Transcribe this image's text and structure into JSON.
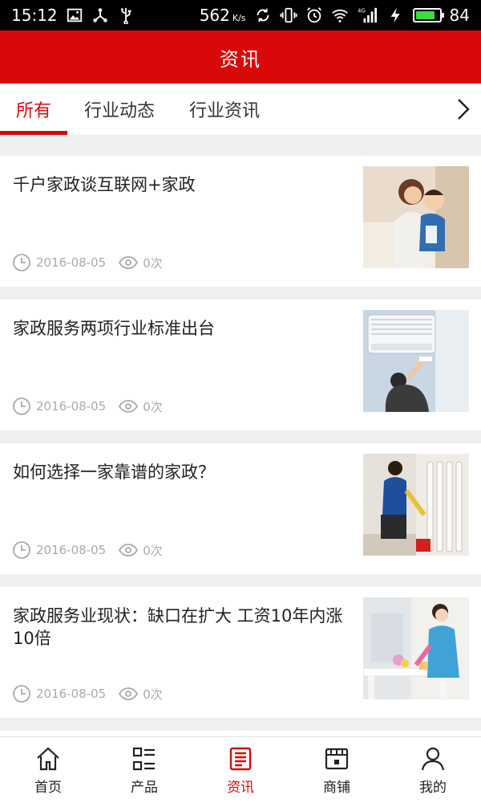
{
  "status_bar": {
    "time": "15:12",
    "net_speed": "562",
    "net_unit": "K/s",
    "network_type": "4G",
    "battery_level": 84,
    "icons": [
      "image-icon",
      "share-icon",
      "usb-icon",
      "sync-icon",
      "vibrate-icon",
      "alarm-icon",
      "wifi-icon",
      "signal-icon",
      "charging-icon",
      "battery-icon"
    ]
  },
  "header": {
    "title": "资讯"
  },
  "tabs": [
    {
      "label": "所有",
      "active": true
    },
    {
      "label": "行业动态",
      "active": false
    },
    {
      "label": "行业资讯",
      "active": false
    }
  ],
  "news": [
    {
      "title": "千户家政谈互联网+家政",
      "date": "2016-08-05",
      "views": "0次",
      "image": "mother-and-child-photo"
    },
    {
      "title": "家政服务两项行业标准出台",
      "date": "2016-08-05",
      "views": "0次",
      "image": "aircon-cleaning-photo"
    },
    {
      "title": "如何选择一家靠谱的家政？",
      "date": "2016-08-05",
      "views": "0次",
      "image": "railing-cleaning-photo"
    },
    {
      "title": "家政服务业现状：缺口在扩大 工资10年内涨10倍",
      "date": "2016-08-05",
      "views": "0次",
      "image": "housekeeper-table-photo"
    }
  ],
  "bottom_nav": [
    {
      "label": "首页",
      "icon": "home-icon",
      "active": false
    },
    {
      "label": "产品",
      "icon": "list-grid-icon",
      "active": false
    },
    {
      "label": "资讯",
      "icon": "news-icon",
      "active": true
    },
    {
      "label": "商铺",
      "icon": "store-icon",
      "active": false
    },
    {
      "label": "我的",
      "icon": "person-icon",
      "active": false
    }
  ],
  "colors": {
    "accent": "#d9090a",
    "battery": "#3ddc3d",
    "meta": "#aaaaaa"
  }
}
